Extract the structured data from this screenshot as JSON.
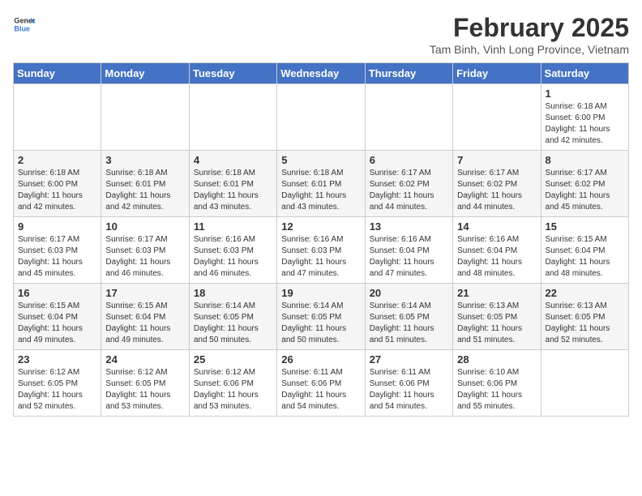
{
  "header": {
    "logo_general": "General",
    "logo_blue": "Blue",
    "month_year": "February 2025",
    "location": "Tam Binh, Vinh Long Province, Vietnam"
  },
  "weekdays": [
    "Sunday",
    "Monday",
    "Tuesday",
    "Wednesday",
    "Thursday",
    "Friday",
    "Saturday"
  ],
  "weeks": [
    [
      {
        "day": "",
        "info": ""
      },
      {
        "day": "",
        "info": ""
      },
      {
        "day": "",
        "info": ""
      },
      {
        "day": "",
        "info": ""
      },
      {
        "day": "",
        "info": ""
      },
      {
        "day": "",
        "info": ""
      },
      {
        "day": "1",
        "info": "Sunrise: 6:18 AM\nSunset: 6:00 PM\nDaylight: 11 hours\nand 42 minutes."
      }
    ],
    [
      {
        "day": "2",
        "info": "Sunrise: 6:18 AM\nSunset: 6:00 PM\nDaylight: 11 hours\nand 42 minutes."
      },
      {
        "day": "3",
        "info": "Sunrise: 6:18 AM\nSunset: 6:01 PM\nDaylight: 11 hours\nand 42 minutes."
      },
      {
        "day": "4",
        "info": "Sunrise: 6:18 AM\nSunset: 6:01 PM\nDaylight: 11 hours\nand 43 minutes."
      },
      {
        "day": "5",
        "info": "Sunrise: 6:18 AM\nSunset: 6:01 PM\nDaylight: 11 hours\nand 43 minutes."
      },
      {
        "day": "6",
        "info": "Sunrise: 6:17 AM\nSunset: 6:02 PM\nDaylight: 11 hours\nand 44 minutes."
      },
      {
        "day": "7",
        "info": "Sunrise: 6:17 AM\nSunset: 6:02 PM\nDaylight: 11 hours\nand 44 minutes."
      },
      {
        "day": "8",
        "info": "Sunrise: 6:17 AM\nSunset: 6:02 PM\nDaylight: 11 hours\nand 45 minutes."
      }
    ],
    [
      {
        "day": "9",
        "info": "Sunrise: 6:17 AM\nSunset: 6:03 PM\nDaylight: 11 hours\nand 45 minutes."
      },
      {
        "day": "10",
        "info": "Sunrise: 6:17 AM\nSunset: 6:03 PM\nDaylight: 11 hours\nand 46 minutes."
      },
      {
        "day": "11",
        "info": "Sunrise: 6:16 AM\nSunset: 6:03 PM\nDaylight: 11 hours\nand 46 minutes."
      },
      {
        "day": "12",
        "info": "Sunrise: 6:16 AM\nSunset: 6:03 PM\nDaylight: 11 hours\nand 47 minutes."
      },
      {
        "day": "13",
        "info": "Sunrise: 6:16 AM\nSunset: 6:04 PM\nDaylight: 11 hours\nand 47 minutes."
      },
      {
        "day": "14",
        "info": "Sunrise: 6:16 AM\nSunset: 6:04 PM\nDaylight: 11 hours\nand 48 minutes."
      },
      {
        "day": "15",
        "info": "Sunrise: 6:15 AM\nSunset: 6:04 PM\nDaylight: 11 hours\nand 48 minutes."
      }
    ],
    [
      {
        "day": "16",
        "info": "Sunrise: 6:15 AM\nSunset: 6:04 PM\nDaylight: 11 hours\nand 49 minutes."
      },
      {
        "day": "17",
        "info": "Sunrise: 6:15 AM\nSunset: 6:04 PM\nDaylight: 11 hours\nand 49 minutes."
      },
      {
        "day": "18",
        "info": "Sunrise: 6:14 AM\nSunset: 6:05 PM\nDaylight: 11 hours\nand 50 minutes."
      },
      {
        "day": "19",
        "info": "Sunrise: 6:14 AM\nSunset: 6:05 PM\nDaylight: 11 hours\nand 50 minutes."
      },
      {
        "day": "20",
        "info": "Sunrise: 6:14 AM\nSunset: 6:05 PM\nDaylight: 11 hours\nand 51 minutes."
      },
      {
        "day": "21",
        "info": "Sunrise: 6:13 AM\nSunset: 6:05 PM\nDaylight: 11 hours\nand 51 minutes."
      },
      {
        "day": "22",
        "info": "Sunrise: 6:13 AM\nSunset: 6:05 PM\nDaylight: 11 hours\nand 52 minutes."
      }
    ],
    [
      {
        "day": "23",
        "info": "Sunrise: 6:12 AM\nSunset: 6:05 PM\nDaylight: 11 hours\nand 52 minutes."
      },
      {
        "day": "24",
        "info": "Sunrise: 6:12 AM\nSunset: 6:05 PM\nDaylight: 11 hours\nand 53 minutes."
      },
      {
        "day": "25",
        "info": "Sunrise: 6:12 AM\nSunset: 6:06 PM\nDaylight: 11 hours\nand 53 minutes."
      },
      {
        "day": "26",
        "info": "Sunrise: 6:11 AM\nSunset: 6:06 PM\nDaylight: 11 hours\nand 54 minutes."
      },
      {
        "day": "27",
        "info": "Sunrise: 6:11 AM\nSunset: 6:06 PM\nDaylight: 11 hours\nand 54 minutes."
      },
      {
        "day": "28",
        "info": "Sunrise: 6:10 AM\nSunset: 6:06 PM\nDaylight: 11 hours\nand 55 minutes."
      },
      {
        "day": "",
        "info": ""
      }
    ]
  ]
}
